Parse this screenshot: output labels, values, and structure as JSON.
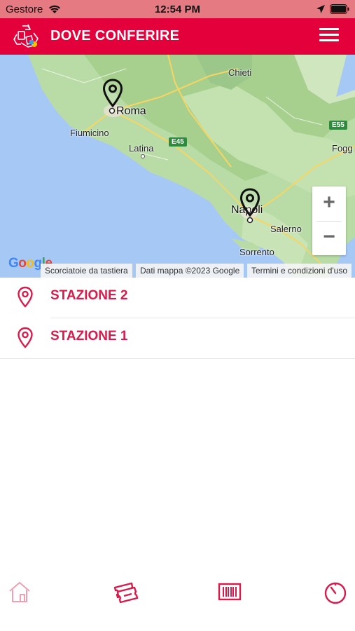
{
  "status_bar": {
    "carrier": "Gestore",
    "time": "12:54 PM"
  },
  "header": {
    "title": "DOVE CONFERIRE",
    "logo_icon": "recycle-logo-icon",
    "menu_icon": "hamburger-menu-icon"
  },
  "map": {
    "cities": {
      "roma": "Roma",
      "chieti": "Chieti",
      "fiumicino": "Fiumicino",
      "latina": "Latina",
      "napoli": "Napoli",
      "salerno": "Salerno",
      "sorrento": "Sorrento",
      "foggia": "Fogg"
    },
    "roads": {
      "e45": "E45",
      "e55": "E55"
    },
    "zoom_in": "+",
    "zoom_out": "−",
    "google_logo": "Google",
    "attribution": {
      "shortcuts": "Scorciatoie da tastiera",
      "map_data": "Dati mappa ©2023 Google",
      "terms": "Termini e condizioni d'uso"
    }
  },
  "stations": [
    {
      "name": "STAZIONE 2"
    },
    {
      "name": "STAZIONE 1"
    }
  ],
  "tabs": [
    {
      "icon": "home-icon"
    },
    {
      "icon": "ticket-icon"
    },
    {
      "icon": "barcode-icon"
    },
    {
      "icon": "timer-icon"
    }
  ],
  "colors": {
    "brand": "#e4003a",
    "status_bar": "#e57a83",
    "station_text": "#d81b4a"
  }
}
